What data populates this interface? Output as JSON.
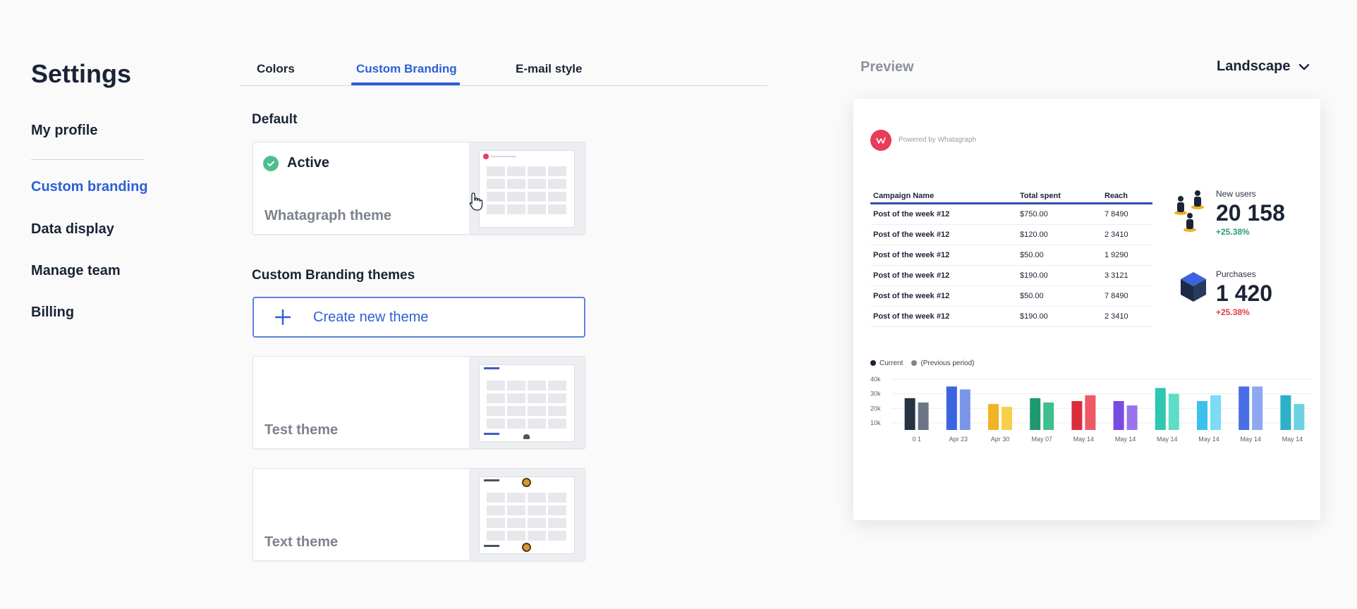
{
  "nav": {
    "title": "Settings",
    "items": [
      "My profile",
      "Custom branding",
      "Data display",
      "Manage team",
      "Billing"
    ],
    "active_index": 1
  },
  "tabs": {
    "items": [
      "Colors",
      "Custom Branding",
      "E-mail style"
    ],
    "active_index": 1
  },
  "default_section": {
    "title": "Default",
    "active_label": "Active",
    "theme_name": "Whatagraph theme"
  },
  "custom_section": {
    "title": "Custom Branding themes",
    "create_label": "Create new theme",
    "themes": [
      "Test theme",
      "Text theme"
    ]
  },
  "preview": {
    "label": "Preview",
    "orientation": "Landscape",
    "powered_by": "Powered by Whatagraph",
    "table": {
      "headers": [
        "Campaign Name",
        "Total spent",
        "Reach"
      ],
      "rows": [
        [
          "Post of the week #12",
          "$750.00",
          "7 8490"
        ],
        [
          "Post of the week #12",
          "$120.00",
          "2 3410"
        ],
        [
          "Post of the week #12",
          "$50.00",
          "1 9290"
        ],
        [
          "Post of the week #12",
          "$190.00",
          "3 3121"
        ],
        [
          "Post of the week #12",
          "$50.00",
          "7 8490"
        ],
        [
          "Post of the week #12",
          "$190.00",
          "2 3410"
        ]
      ]
    },
    "kpis": [
      {
        "label": "New users",
        "value": "20 158",
        "delta": "+25.38%",
        "delta_color": "#2a9d78",
        "icon": "users-icon"
      },
      {
        "label": "Purchases",
        "value": "1 420",
        "delta": "+25.38%",
        "delta_color": "#e03b45",
        "icon": "cube-icon"
      }
    ]
  },
  "colors": {
    "accent": "#2c5fd6",
    "success": "#4cbf8f",
    "brand_logo": "#e83c5b"
  },
  "chart_data": {
    "type": "bar",
    "legend": [
      "Current",
      "(Previous period)"
    ],
    "legend_colors": [
      "#1a2435",
      "#7d838d"
    ],
    "categories": [
      "0 1",
      "Apr 23",
      "Apr 30",
      "May 07",
      "May 14",
      "May 14",
      "May 14",
      "May 14",
      "May 14",
      "May 14"
    ],
    "series": [
      {
        "name": "Current",
        "values": [
          27,
          35,
          23,
          27,
          25,
          25,
          34,
          25,
          35,
          29
        ]
      },
      {
        "name": "(Previous period)",
        "values": [
          24,
          33,
          21,
          24,
          29,
          22,
          30,
          29,
          35,
          23
        ]
      }
    ],
    "bar_colors": [
      [
        "#283245",
        "#6b7585"
      ],
      [
        "#3a64e0",
        "#7b95ea"
      ],
      [
        "#f0b324",
        "#f5d04a"
      ],
      [
        "#1f9a6e",
        "#3fbf8e"
      ],
      [
        "#dc2d3e",
        "#ef5865"
      ],
      [
        "#7a4be0",
        "#9a72ee"
      ],
      [
        "#2ec7b0",
        "#5fdcc6"
      ],
      [
        "#3cc0ee",
        "#7adcf5"
      ],
      [
        "#4a6ee6",
        "#8ea7f2"
      ],
      [
        "#2db0c6",
        "#6bd2e2"
      ]
    ],
    "y_ticks": [
      "40k",
      "30k",
      "20k",
      "10k"
    ],
    "ylim": [
      10,
      40
    ],
    "grid": true
  }
}
